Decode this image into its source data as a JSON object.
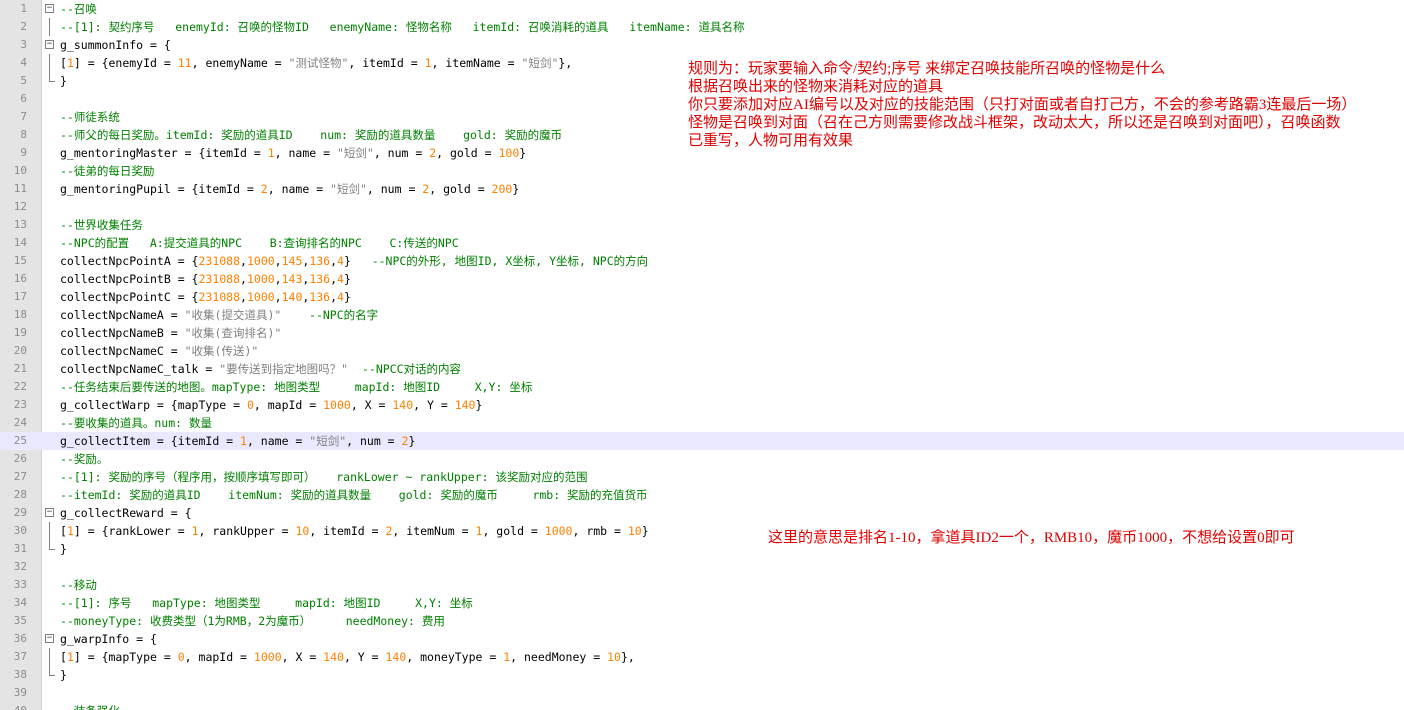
{
  "editor": {
    "lines": [
      {
        "no": "1",
        "fold": "box",
        "parts": [
          {
            "t": "--召唤",
            "c": "c"
          }
        ]
      },
      {
        "no": "2",
        "fold": "bar",
        "parts": [
          {
            "t": "--[1]: 契约序号   enemyId: 召唤的怪物ID   enemyName: 怪物名称   itemId: 召唤消耗的道具   itemName: 道具名称",
            "c": "c"
          }
        ]
      },
      {
        "no": "3",
        "fold": "box",
        "parts": [
          {
            "t": "g_summonInfo = {",
            "c": "k"
          }
        ]
      },
      {
        "no": "4",
        "fold": "bar",
        "parts": [
          {
            "t": "[",
            "c": "k"
          },
          {
            "t": "1",
            "c": "n"
          },
          {
            "t": "] = {enemyId = ",
            "c": "k"
          },
          {
            "t": "11",
            "c": "n"
          },
          {
            "t": ", enemyName = ",
            "c": "k"
          },
          {
            "t": "\"测试怪物\"",
            "c": "s"
          },
          {
            "t": ", itemId = ",
            "c": "k"
          },
          {
            "t": "1",
            "c": "n"
          },
          {
            "t": ", itemName = ",
            "c": "k"
          },
          {
            "t": "\"短剑\"",
            "c": "s"
          },
          {
            "t": "},",
            "c": "k"
          }
        ]
      },
      {
        "no": "5",
        "fold": "end",
        "parts": [
          {
            "t": "}",
            "c": "k"
          }
        ]
      },
      {
        "no": "6",
        "fold": "",
        "parts": []
      },
      {
        "no": "7",
        "fold": "",
        "parts": [
          {
            "t": "--师徒系统",
            "c": "c"
          }
        ]
      },
      {
        "no": "8",
        "fold": "",
        "parts": [
          {
            "t": "--师父的每日奖励。itemId: 奖励的道具ID    num: 奖励的道具数量    gold: 奖励的魔币",
            "c": "c"
          }
        ]
      },
      {
        "no": "9",
        "fold": "",
        "parts": [
          {
            "t": "g_mentoringMaster = {itemId = ",
            "c": "k"
          },
          {
            "t": "1",
            "c": "n"
          },
          {
            "t": ", name = ",
            "c": "k"
          },
          {
            "t": "\"短剑\"",
            "c": "s"
          },
          {
            "t": ", num = ",
            "c": "k"
          },
          {
            "t": "2",
            "c": "n"
          },
          {
            "t": ", gold = ",
            "c": "k"
          },
          {
            "t": "100",
            "c": "n"
          },
          {
            "t": "}",
            "c": "k"
          }
        ]
      },
      {
        "no": "10",
        "fold": "",
        "parts": [
          {
            "t": "--徒弟的每日奖励",
            "c": "c"
          }
        ]
      },
      {
        "no": "11",
        "fold": "",
        "parts": [
          {
            "t": "g_mentoringPupil = {itemId = ",
            "c": "k"
          },
          {
            "t": "2",
            "c": "n"
          },
          {
            "t": ", name = ",
            "c": "k"
          },
          {
            "t": "\"短剑\"",
            "c": "s"
          },
          {
            "t": ", num = ",
            "c": "k"
          },
          {
            "t": "2",
            "c": "n"
          },
          {
            "t": ", gold = ",
            "c": "k"
          },
          {
            "t": "200",
            "c": "n"
          },
          {
            "t": "}",
            "c": "k"
          }
        ]
      },
      {
        "no": "12",
        "fold": "",
        "parts": []
      },
      {
        "no": "13",
        "fold": "",
        "parts": [
          {
            "t": "--世界收集任务",
            "c": "c"
          }
        ]
      },
      {
        "no": "14",
        "fold": "",
        "parts": [
          {
            "t": "--NPC的配置   A:提交道具的NPC    B:查询排名的NPC    C:传送的NPC",
            "c": "c"
          }
        ]
      },
      {
        "no": "15",
        "fold": "",
        "parts": [
          {
            "t": "collectNpcPointA = {",
            "c": "k"
          },
          {
            "t": "231088",
            "c": "n"
          },
          {
            "t": ",",
            "c": "k"
          },
          {
            "t": "1000",
            "c": "n"
          },
          {
            "t": ",",
            "c": "k"
          },
          {
            "t": "145",
            "c": "n"
          },
          {
            "t": ",",
            "c": "k"
          },
          {
            "t": "136",
            "c": "n"
          },
          {
            "t": ",",
            "c": "k"
          },
          {
            "t": "4",
            "c": "n"
          },
          {
            "t": "}   ",
            "c": "k"
          },
          {
            "t": "--NPC的外形, 地图ID, X坐标, Y坐标, NPC的方向",
            "c": "c"
          }
        ]
      },
      {
        "no": "16",
        "fold": "",
        "parts": [
          {
            "t": "collectNpcPointB = {",
            "c": "k"
          },
          {
            "t": "231088",
            "c": "n"
          },
          {
            "t": ",",
            "c": "k"
          },
          {
            "t": "1000",
            "c": "n"
          },
          {
            "t": ",",
            "c": "k"
          },
          {
            "t": "143",
            "c": "n"
          },
          {
            "t": ",",
            "c": "k"
          },
          {
            "t": "136",
            "c": "n"
          },
          {
            "t": ",",
            "c": "k"
          },
          {
            "t": "4",
            "c": "n"
          },
          {
            "t": "}",
            "c": "k"
          }
        ]
      },
      {
        "no": "17",
        "fold": "",
        "parts": [
          {
            "t": "collectNpcPointC = {",
            "c": "k"
          },
          {
            "t": "231088",
            "c": "n"
          },
          {
            "t": ",",
            "c": "k"
          },
          {
            "t": "1000",
            "c": "n"
          },
          {
            "t": ",",
            "c": "k"
          },
          {
            "t": "140",
            "c": "n"
          },
          {
            "t": ",",
            "c": "k"
          },
          {
            "t": "136",
            "c": "n"
          },
          {
            "t": ",",
            "c": "k"
          },
          {
            "t": "4",
            "c": "n"
          },
          {
            "t": "}",
            "c": "k"
          }
        ]
      },
      {
        "no": "18",
        "fold": "",
        "parts": [
          {
            "t": "collectNpcNameA = ",
            "c": "k"
          },
          {
            "t": "\"收集(提交道具)\"",
            "c": "s"
          },
          {
            "t": "    ",
            "c": "k"
          },
          {
            "t": "--NPC的名字",
            "c": "c"
          }
        ]
      },
      {
        "no": "19",
        "fold": "",
        "parts": [
          {
            "t": "collectNpcNameB = ",
            "c": "k"
          },
          {
            "t": "\"收集(查询排名)\"",
            "c": "s"
          }
        ]
      },
      {
        "no": "20",
        "fold": "",
        "parts": [
          {
            "t": "collectNpcNameC = ",
            "c": "k"
          },
          {
            "t": "\"收集(传送)\"",
            "c": "s"
          }
        ]
      },
      {
        "no": "21",
        "fold": "",
        "parts": [
          {
            "t": "collectNpcNameC_talk = ",
            "c": "k"
          },
          {
            "t": "\"要传送到指定地图吗？\"",
            "c": "s"
          },
          {
            "t": "  ",
            "c": "k"
          },
          {
            "t": "--NPCC对话的内容",
            "c": "c"
          }
        ]
      },
      {
        "no": "22",
        "fold": "",
        "parts": [
          {
            "t": "--任务结束后要传送的地图。mapType: 地图类型     mapId: 地图ID     X,Y: 坐标",
            "c": "c"
          }
        ]
      },
      {
        "no": "23",
        "fold": "",
        "parts": [
          {
            "t": "g_collectWarp = {mapType = ",
            "c": "k"
          },
          {
            "t": "0",
            "c": "n"
          },
          {
            "t": ", mapId = ",
            "c": "k"
          },
          {
            "t": "1000",
            "c": "n"
          },
          {
            "t": ", X = ",
            "c": "k"
          },
          {
            "t": "140",
            "c": "n"
          },
          {
            "t": ", Y = ",
            "c": "k"
          },
          {
            "t": "140",
            "c": "n"
          },
          {
            "t": "}",
            "c": "k"
          }
        ]
      },
      {
        "no": "24",
        "fold": "",
        "parts": [
          {
            "t": "--要收集的道具。num: 数量",
            "c": "c"
          }
        ]
      },
      {
        "no": "25",
        "fold": "",
        "current": true,
        "parts": [
          {
            "t": "g_collectItem = {itemId = ",
            "c": "k"
          },
          {
            "t": "1",
            "c": "n"
          },
          {
            "t": ", name = ",
            "c": "k"
          },
          {
            "t": "\"短剑\"",
            "c": "s"
          },
          {
            "t": ", num = ",
            "c": "k"
          },
          {
            "t": "2",
            "c": "n"
          },
          {
            "t": "}",
            "c": "k"
          }
        ]
      },
      {
        "no": "26",
        "fold": "",
        "parts": [
          {
            "t": "--奖励。",
            "c": "c"
          }
        ]
      },
      {
        "no": "27",
        "fold": "",
        "parts": [
          {
            "t": "--[1]: 奖励的序号（程序用，按顺序填写即可）   rankLower ~ rankUpper: 该奖励对应的范围",
            "c": "c"
          }
        ]
      },
      {
        "no": "28",
        "fold": "",
        "parts": [
          {
            "t": "--itemId: 奖励的道具ID    itemNum: 奖励的道具数量    gold: 奖励的魔币     rmb: 奖励的充值货币",
            "c": "c"
          }
        ]
      },
      {
        "no": "29",
        "fold": "box",
        "parts": [
          {
            "t": "g_collectReward = {",
            "c": "k"
          }
        ]
      },
      {
        "no": "30",
        "fold": "bar",
        "parts": [
          {
            "t": "[",
            "c": "k"
          },
          {
            "t": "1",
            "c": "n"
          },
          {
            "t": "] = {rankLower = ",
            "c": "k"
          },
          {
            "t": "1",
            "c": "n"
          },
          {
            "t": ", rankUpper = ",
            "c": "k"
          },
          {
            "t": "10",
            "c": "n"
          },
          {
            "t": ", itemId = ",
            "c": "k"
          },
          {
            "t": "2",
            "c": "n"
          },
          {
            "t": ", itemNum = ",
            "c": "k"
          },
          {
            "t": "1",
            "c": "n"
          },
          {
            "t": ", gold = ",
            "c": "k"
          },
          {
            "t": "1000",
            "c": "n"
          },
          {
            "t": ", rmb = ",
            "c": "k"
          },
          {
            "t": "10",
            "c": "n"
          },
          {
            "t": "}",
            "c": "k"
          }
        ]
      },
      {
        "no": "31",
        "fold": "end",
        "parts": [
          {
            "t": "}",
            "c": "k"
          }
        ]
      },
      {
        "no": "32",
        "fold": "",
        "parts": []
      },
      {
        "no": "33",
        "fold": "",
        "parts": [
          {
            "t": "--移动",
            "c": "c"
          }
        ]
      },
      {
        "no": "34",
        "fold": "",
        "parts": [
          {
            "t": "--[1]: 序号   mapType: 地图类型     mapId: 地图ID     X,Y: 坐标",
            "c": "c"
          }
        ]
      },
      {
        "no": "35",
        "fold": "",
        "parts": [
          {
            "t": "--moneyType: 收费类型（1为RMB，2为魔币）     needMoney: 费用",
            "c": "c"
          }
        ]
      },
      {
        "no": "36",
        "fold": "box",
        "parts": [
          {
            "t": "g_warpInfo = {",
            "c": "k"
          }
        ]
      },
      {
        "no": "37",
        "fold": "bar",
        "parts": [
          {
            "t": "[",
            "c": "k"
          },
          {
            "t": "1",
            "c": "n"
          },
          {
            "t": "] = {mapType = ",
            "c": "k"
          },
          {
            "t": "0",
            "c": "n"
          },
          {
            "t": ", mapId = ",
            "c": "k"
          },
          {
            "t": "1000",
            "c": "n"
          },
          {
            "t": ", X = ",
            "c": "k"
          },
          {
            "t": "140",
            "c": "n"
          },
          {
            "t": ", Y = ",
            "c": "k"
          },
          {
            "t": "140",
            "c": "n"
          },
          {
            "t": ", moneyType = ",
            "c": "k"
          },
          {
            "t": "1",
            "c": "n"
          },
          {
            "t": ", needMoney = ",
            "c": "k"
          },
          {
            "t": "10",
            "c": "n"
          },
          {
            "t": "},",
            "c": "k"
          }
        ]
      },
      {
        "no": "38",
        "fold": "end",
        "parts": [
          {
            "t": "}",
            "c": "k"
          }
        ]
      },
      {
        "no": "39",
        "fold": "",
        "parts": []
      },
      {
        "no": "40",
        "fold": "",
        "parts": [
          {
            "t": "--装备强化",
            "c": "c"
          }
        ]
      }
    ]
  },
  "notes": {
    "top": [
      "规则为：玩家要输入命令/契约;序号  来绑定召唤技能所召唤的怪物是什么",
      "根据召唤出来的怪物来消耗对应的道具",
      "你只要添加对应AI编号以及对应的技能范围（只打对面或者自打己方，不会的参考路霸3连最后一场）",
      "怪物是召唤到对面（召在己方则需要修改战斗框架，改动太大，所以还是召唤到对面吧），召唤函数",
      "已重写，人物可用有效果"
    ],
    "reward": "这里的意思是排名1-10，拿道具ID2一个，RMB10，魔币1000，不想给设置0即可"
  },
  "colors": {
    "comment": "#008000",
    "number": "#ff8000",
    "string": "#808080",
    "note": "#e00000",
    "current_line": "#e8e8ff",
    "gutter": "#e4e4e4"
  }
}
